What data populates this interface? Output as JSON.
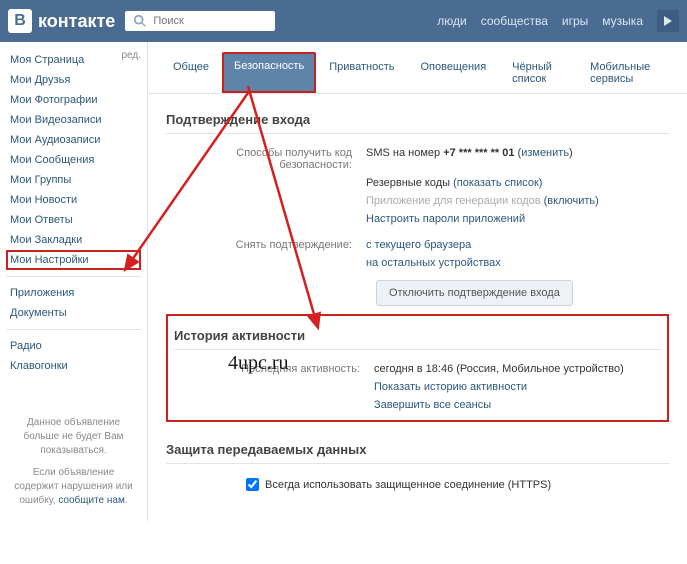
{
  "header": {
    "brand": "контакте",
    "logo_letter": "B",
    "search_placeholder": "Поиск",
    "nav": {
      "people": "люди",
      "communities": "сообщества",
      "games": "игры",
      "music": "музыка"
    }
  },
  "sidebar": {
    "edit": "ред.",
    "items": [
      "Моя Страница",
      "Мои Друзья",
      "Мои Фотографии",
      "Мои Видеозаписи",
      "Мои Аудиозаписи",
      "Мои Сообщения",
      "Мои Группы",
      "Мои Новости",
      "Мои Ответы",
      "Мои Закладки",
      "Мои Настройки"
    ],
    "items2": [
      "Приложения",
      "Документы"
    ],
    "items3": [
      "Радио",
      "Клавогонки"
    ],
    "ad1": "Данное объявление больше не будет Вам показываться.",
    "ad2_a": "Если объявление содержит нарушения или ошибку, ",
    "ad2_link": "сообщите нам"
  },
  "tabs": {
    "general": "Общее",
    "security": "Безопасность",
    "privacy": "Приватность",
    "notifications": "Оповещения",
    "blacklist": "Чёрный список",
    "mobile": "Мобильные сервисы"
  },
  "sec1": {
    "title": "Подтверждение входа",
    "r1_label": "Способы получить код безопасности:",
    "r1_val_a": "SMS на номер ",
    "r1_val_b": "+7 *** *** ** 01",
    "r1_change": "изменить",
    "r2_a": "Резервные коды ",
    "r2_link": "(показать список)",
    "r3_a": "Приложение для генерации кодов ",
    "r3_link": "(включить)",
    "r4_link": "Настроить пароли приложений",
    "r5_label": "Снять подтверждение:",
    "r5_link": "с текущего браузера",
    "r6_link": "на остальных устройствах",
    "btn": "Отключить подтверждение входа"
  },
  "sec2": {
    "title": "История активности",
    "r1_label": "Последняя активность:",
    "r1_val": "сегодня в 18:46 (Россия, Мобильное устройство)",
    "r2_link": "Показать историю активности",
    "r3_link": "Завершить все сеансы"
  },
  "sec3": {
    "title": "Защита передаваемых данных",
    "checkbox": "Всегда использовать защищенное соединение (HTTPS)"
  },
  "watermark": "4upc.ru"
}
